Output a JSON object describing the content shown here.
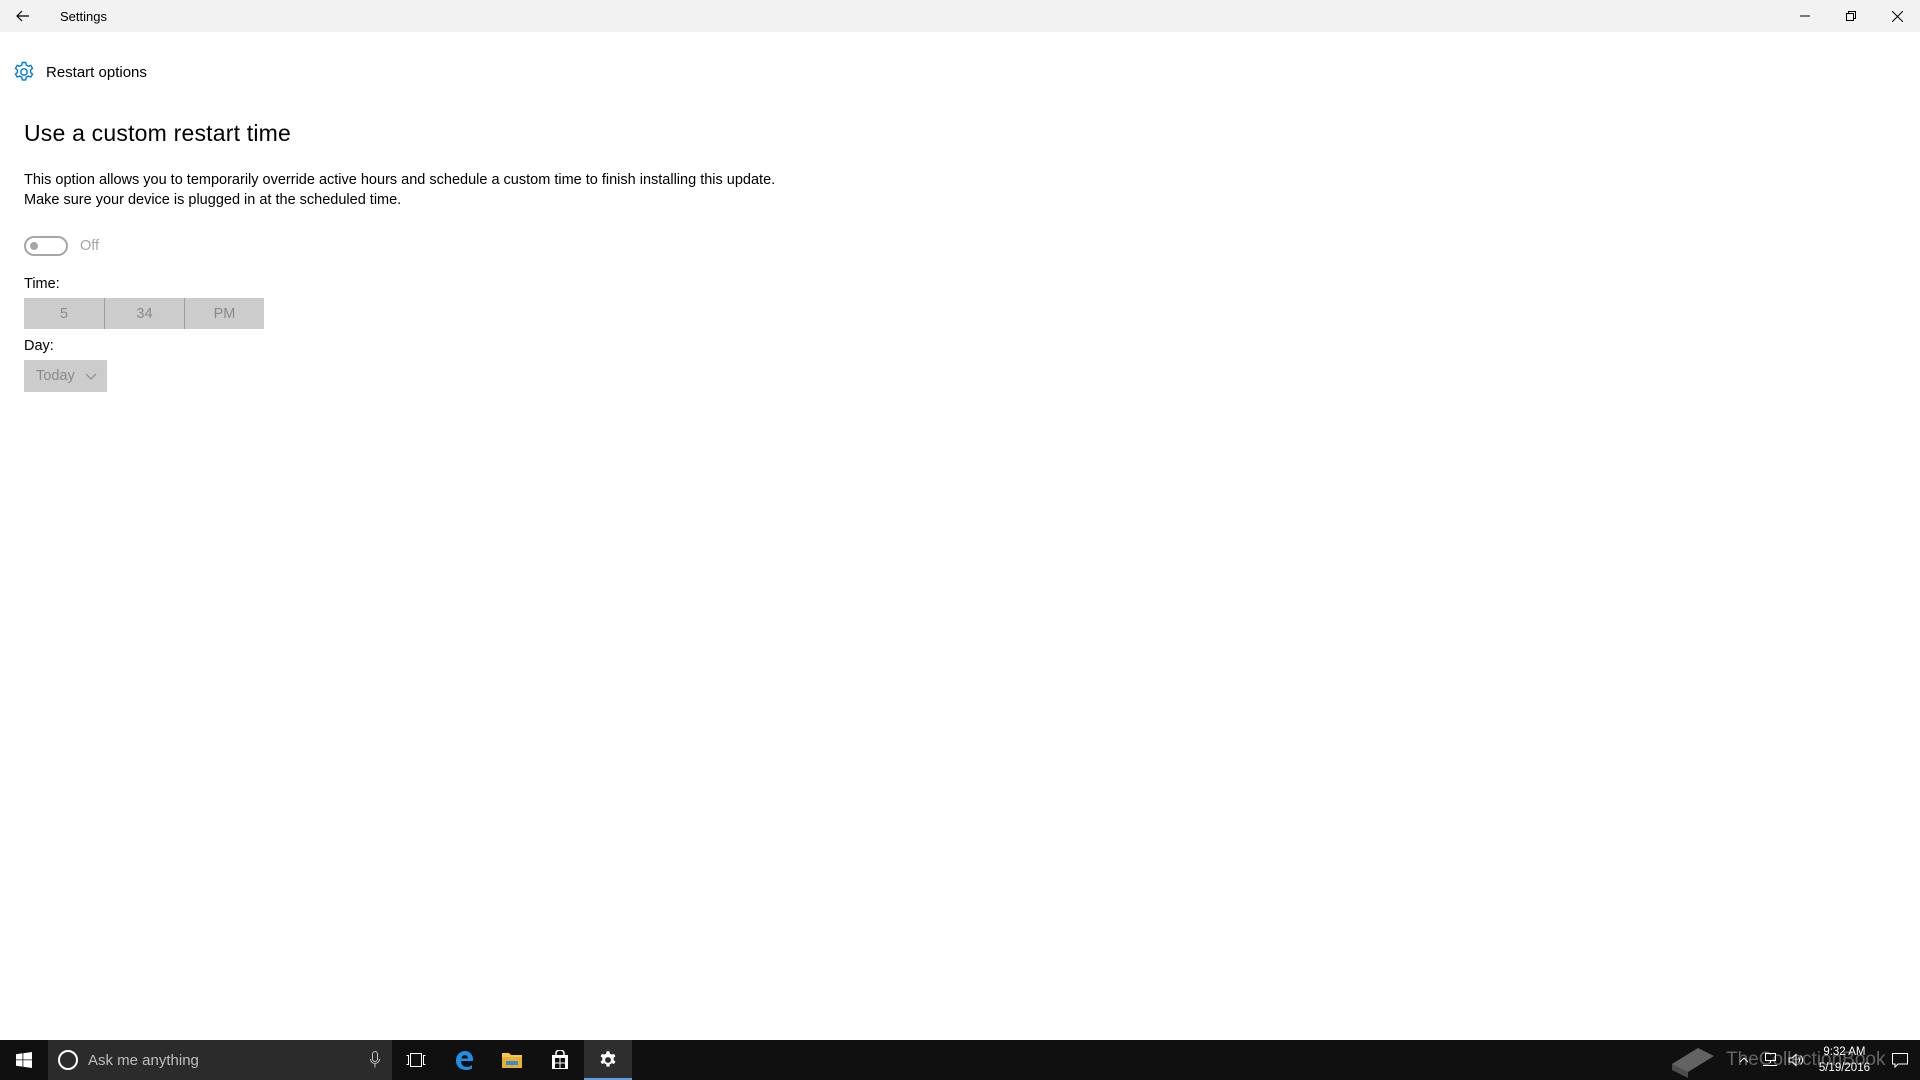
{
  "window": {
    "title": "Settings"
  },
  "page": {
    "title": "Restart options"
  },
  "section": {
    "title": "Use a custom restart time",
    "desc_line1": "This option allows you to temporarily override active hours and schedule a custom time to finish installing this update.",
    "desc_line2": "Make sure your device is plugged in at the scheduled time."
  },
  "toggle": {
    "state": "Off"
  },
  "time": {
    "label": "Time:",
    "hour": "5",
    "minute": "34",
    "period": "PM"
  },
  "day": {
    "label": "Day:",
    "value": "Today"
  },
  "taskbar": {
    "search_placeholder": "Ask me anything",
    "time": "9:32 AM",
    "date": "5/19/2016",
    "watermark": "TheCollectionBook"
  },
  "colors": {
    "accent": "#0078d7",
    "disabled_text": "#8a8a8a",
    "disabled_bg": "#cccccc"
  }
}
